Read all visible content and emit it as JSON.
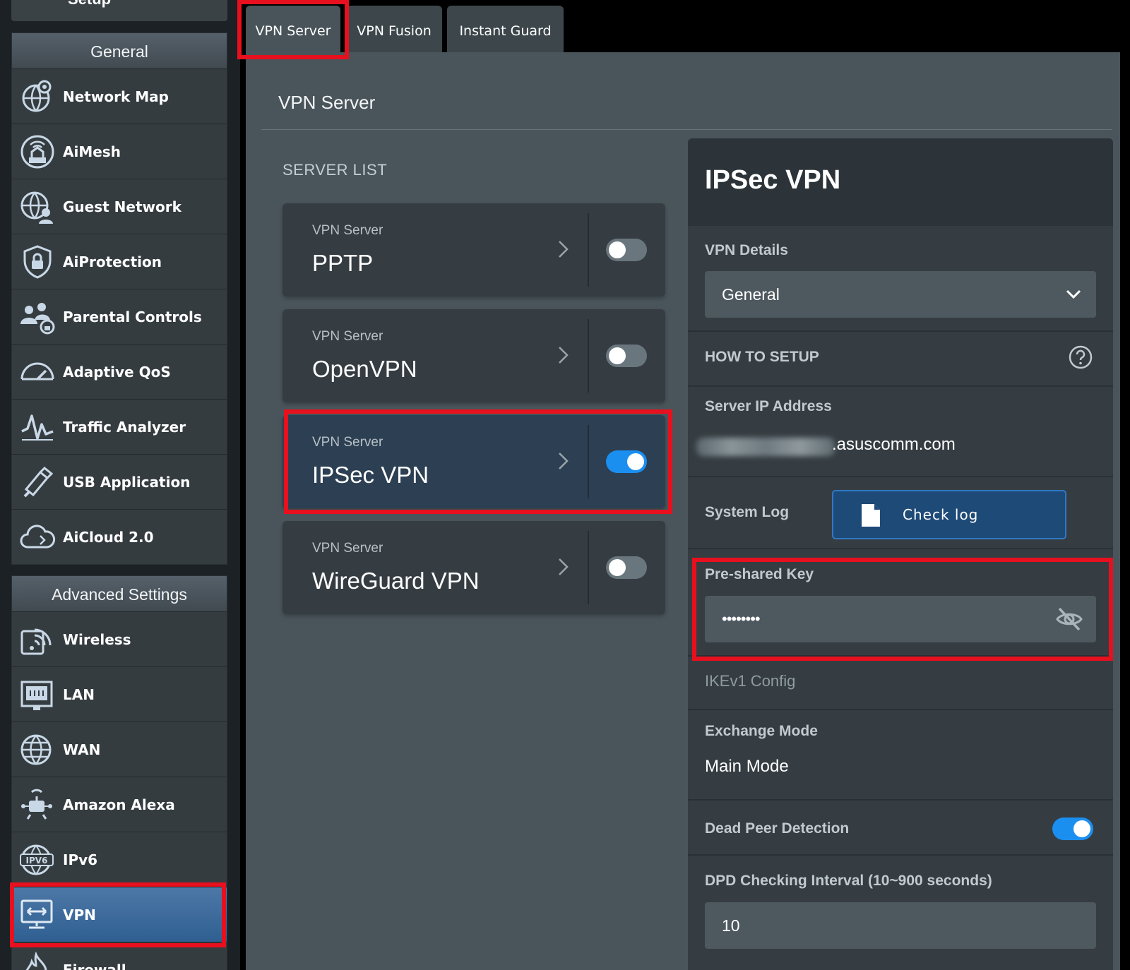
{
  "sidebar": {
    "top_item": "Setup",
    "general": {
      "title": "General",
      "items": [
        {
          "label": "Network Map",
          "icon": "network-map-icon"
        },
        {
          "label": "AiMesh",
          "icon": "aimesh-icon"
        },
        {
          "label": "Guest Network",
          "icon": "guest-network-icon"
        },
        {
          "label": "AiProtection",
          "icon": "aiprotection-icon"
        },
        {
          "label": "Parental Controls",
          "icon": "parental-controls-icon"
        },
        {
          "label": "Adaptive QoS",
          "icon": "adaptive-qos-icon"
        },
        {
          "label": "Traffic Analyzer",
          "icon": "traffic-analyzer-icon"
        },
        {
          "label": "USB Application",
          "icon": "usb-application-icon"
        },
        {
          "label": "AiCloud 2.0",
          "icon": "aicloud-icon"
        }
      ]
    },
    "advanced": {
      "title": "Advanced Settings",
      "items": [
        {
          "label": "Wireless",
          "icon": "wireless-icon"
        },
        {
          "label": "LAN",
          "icon": "lan-icon"
        },
        {
          "label": "WAN",
          "icon": "wan-icon"
        },
        {
          "label": "Amazon Alexa",
          "icon": "amazon-alexa-icon"
        },
        {
          "label": "IPv6",
          "icon": "ipv6-icon"
        },
        {
          "label": "VPN",
          "icon": "vpn-icon",
          "active": true
        },
        {
          "label": "Firewall",
          "icon": "firewall-icon"
        }
      ]
    }
  },
  "tabs": [
    {
      "label": "VPN Server",
      "active": true
    },
    {
      "label": "VPN Fusion"
    },
    {
      "label": "Instant Guard"
    }
  ],
  "main": {
    "title": "VPN Server",
    "server_list_label": "SERVER LIST",
    "servers": [
      {
        "sub": "VPN Server",
        "name": "PPTP",
        "enabled": false
      },
      {
        "sub": "VPN Server",
        "name": "OpenVPN",
        "enabled": false
      },
      {
        "sub": "VPN Server",
        "name": "IPSec VPN",
        "enabled": true,
        "selected": true
      },
      {
        "sub": "VPN Server",
        "name": "WireGuard VPN",
        "enabled": false
      }
    ]
  },
  "panel": {
    "title": "IPSec VPN",
    "vpn_details_label": "VPN Details",
    "vpn_details_value": "General",
    "how_to_setup": "HOW TO SETUP",
    "server_ip_label": "Server IP Address",
    "server_ip_suffix": ".asuscomm.com",
    "system_log_label": "System Log",
    "check_log_button": "Check log",
    "psk_label": "Pre-shared Key",
    "psk_value": "••••••••",
    "ikev1_label": "IKEv1 Config",
    "exchange_mode_label": "Exchange Mode",
    "exchange_mode_value": "Main Mode",
    "dpd_label": "Dead Peer Detection",
    "dpd_enabled": true,
    "dpd_interval_label": "DPD Checking Interval (10~900 seconds)",
    "dpd_interval_value": "10"
  },
  "colors": {
    "accent_blue": "#1b8ff0",
    "highlight_red": "#e8101e",
    "active_sidebar": "#3f6d9c"
  }
}
